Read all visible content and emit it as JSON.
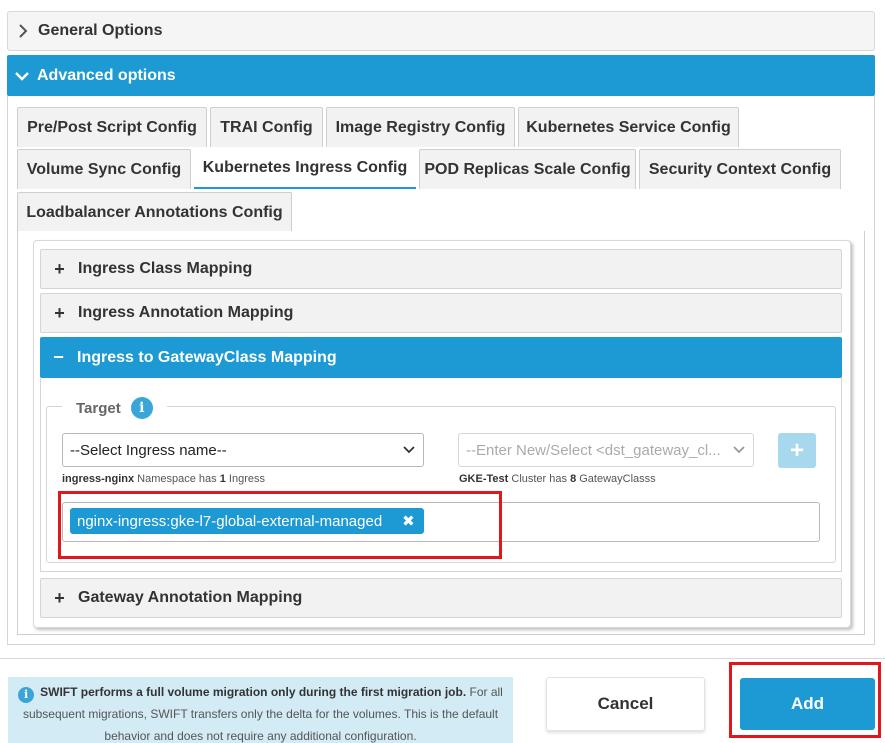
{
  "general_options": {
    "label": "General Options",
    "icon": "chevron-right-icon"
  },
  "advanced_options": {
    "label": "Advanced options",
    "icon": "chevron-down-icon"
  },
  "tabs": [
    {
      "label": "Pre/Post Script Config",
      "active": false
    },
    {
      "label": "TRAI Config",
      "active": false
    },
    {
      "label": "Image Registry Config",
      "active": false
    },
    {
      "label": "Kubernetes Service Config",
      "active": false
    },
    {
      "label": "Volume Sync Config",
      "active": false
    },
    {
      "label": "Kubernetes Ingress Config",
      "active": true
    },
    {
      "label": "POD Replicas Scale Config",
      "active": false
    },
    {
      "label": "Security Context Config",
      "active": false
    },
    {
      "label": "Loadbalancer Annotations Config",
      "active": false
    }
  ],
  "accordions": {
    "ingress_class": {
      "sign": "+",
      "label": "Ingress Class Mapping"
    },
    "ingress_annotation": {
      "sign": "+",
      "label": "Ingress Annotation Mapping"
    },
    "gatewayclass": {
      "sign": "−",
      "label": "Ingress to GatewayClass Mapping"
    },
    "gateway_annotation": {
      "sign": "+",
      "label": "Gateway Annotation Mapping"
    }
  },
  "target": {
    "legend": "Target",
    "info_glyph": "i",
    "ingress_select": {
      "value": "--Select Ingress name--"
    },
    "gateway_select": {
      "placeholder": "--Enter New/Select <dst_gateway_cl..."
    },
    "add_glyph": "+",
    "ingress_hint": {
      "name": "ingress-nginx",
      "text1": " Namespace has ",
      "count": "1",
      "text2": " Ingress"
    },
    "gateway_hint": {
      "name": "GKE-Test",
      "text1": " Cluster has ",
      "count": "8",
      "text2": " GatewayClasss"
    },
    "chip": {
      "label": "nginx-ingress:gke-l7-global-external-managed",
      "remove": "✖"
    }
  },
  "footer": {
    "info_bold": "SWIFT performs a full volume migration only during the first migration job.",
    "info_text": " For all subsequent migrations, SWIFT transfers only the delta for the volumes. This is the default behavior and does not require any additional configuration.",
    "cancel_label": "Cancel",
    "add_label": "Add"
  },
  "colors": {
    "accent": "#1d9ad4",
    "highlight": "#e0161d",
    "info_bg": "#d3ebf4"
  }
}
